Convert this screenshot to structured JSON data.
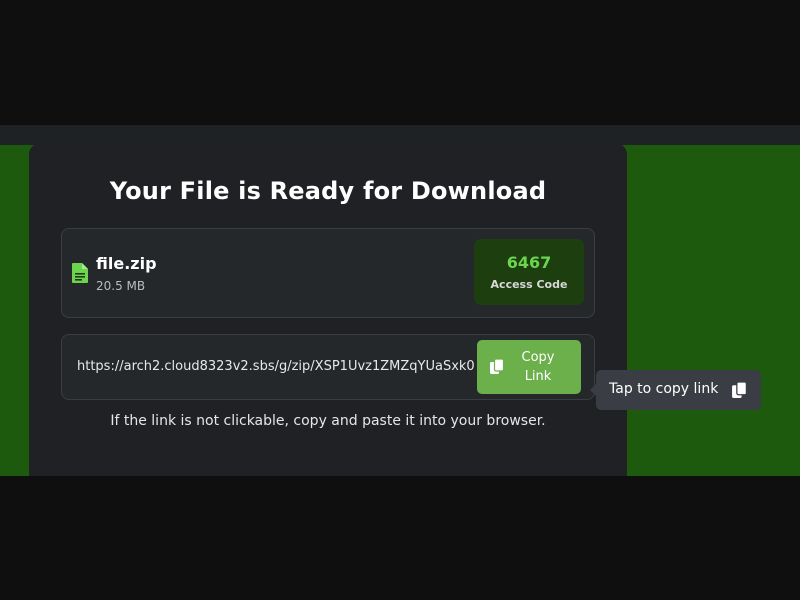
{
  "card": {
    "title": "Your File is Ready for Download"
  },
  "file": {
    "name": "file.zip",
    "size": "20.5 MB",
    "icon": "file-icon"
  },
  "access_code": {
    "value": "6467",
    "label": "Access Code"
  },
  "link": {
    "url": "https://arch2.cloud8323v2.sbs/g/zip/XSP1Uvz1ZMZqYUaSxk0",
    "copy_button_label": "Copy Link",
    "copy_icon": "copy-icon"
  },
  "hint": "If the link is not clickable, copy and paste it into your browser.",
  "tooltip": {
    "text": "Tap to copy link",
    "icon": "copy-icon"
  },
  "colors": {
    "background": "#0f0f0f",
    "green_band": "#1e5a0d",
    "card": "#1f2124",
    "accent_green": "#6cd44f",
    "button_green": "#6bb04a"
  }
}
